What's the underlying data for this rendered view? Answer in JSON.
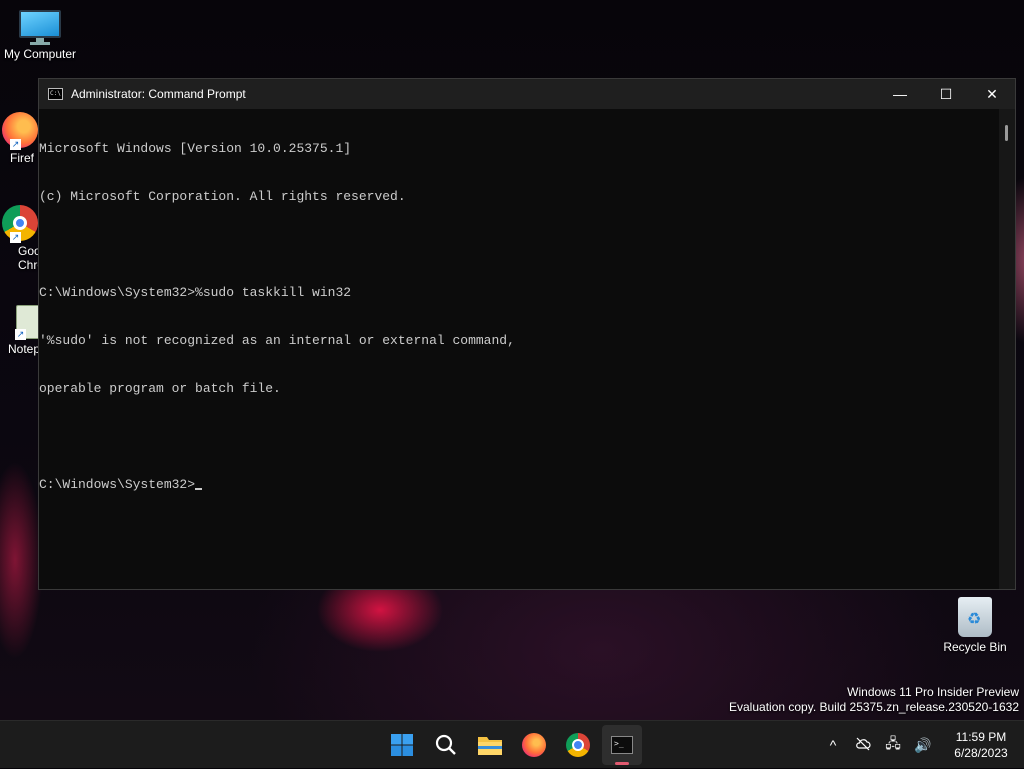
{
  "desktop": {
    "icons": [
      {
        "label": "My Computer",
        "icon": "monitor-icon"
      },
      {
        "label": "Firef",
        "icon": "firefox-icon"
      },
      {
        "label": "Goo\nChro",
        "icon": "chrome-icon"
      },
      {
        "label": "Notep",
        "icon": "notepad-icon"
      },
      {
        "label": "Recycle Bin",
        "icon": "recycle-bin-icon"
      }
    ]
  },
  "window": {
    "title": "Administrator: Command Prompt",
    "minimize_glyph": "—",
    "maximize_glyph": "☐",
    "close_glyph": "✕",
    "lines": [
      "Microsoft Windows [Version 10.0.25375.1]",
      "(c) Microsoft Corporation. All rights reserved.",
      "",
      "C:\\Windows\\System32>%sudo taskkill win32",
      "'%sudo' is not recognized as an internal or external command,",
      "operable program or batch file.",
      "",
      "C:\\Windows\\System32>"
    ]
  },
  "watermark": {
    "line1": "Windows 11 Pro Insider Preview",
    "line2": "Evaluation copy. Build 25375.zn_release.230520-1632"
  },
  "taskbar": {
    "apps": [
      "start-icon",
      "search-icon",
      "file-explorer-icon",
      "firefox-icon",
      "chrome-icon",
      "terminal-icon"
    ],
    "clock": {
      "time": "11:59 PM",
      "date": "6/28/2023"
    },
    "tray": {
      "chevron": "^",
      "network": "🖧",
      "volume": "🔊"
    }
  },
  "colors": {
    "console_bg": "#0c0c0c",
    "console_fg": "#cccccc",
    "taskbar_bg": "#1c1c1c",
    "indicator": "#e05a70"
  }
}
